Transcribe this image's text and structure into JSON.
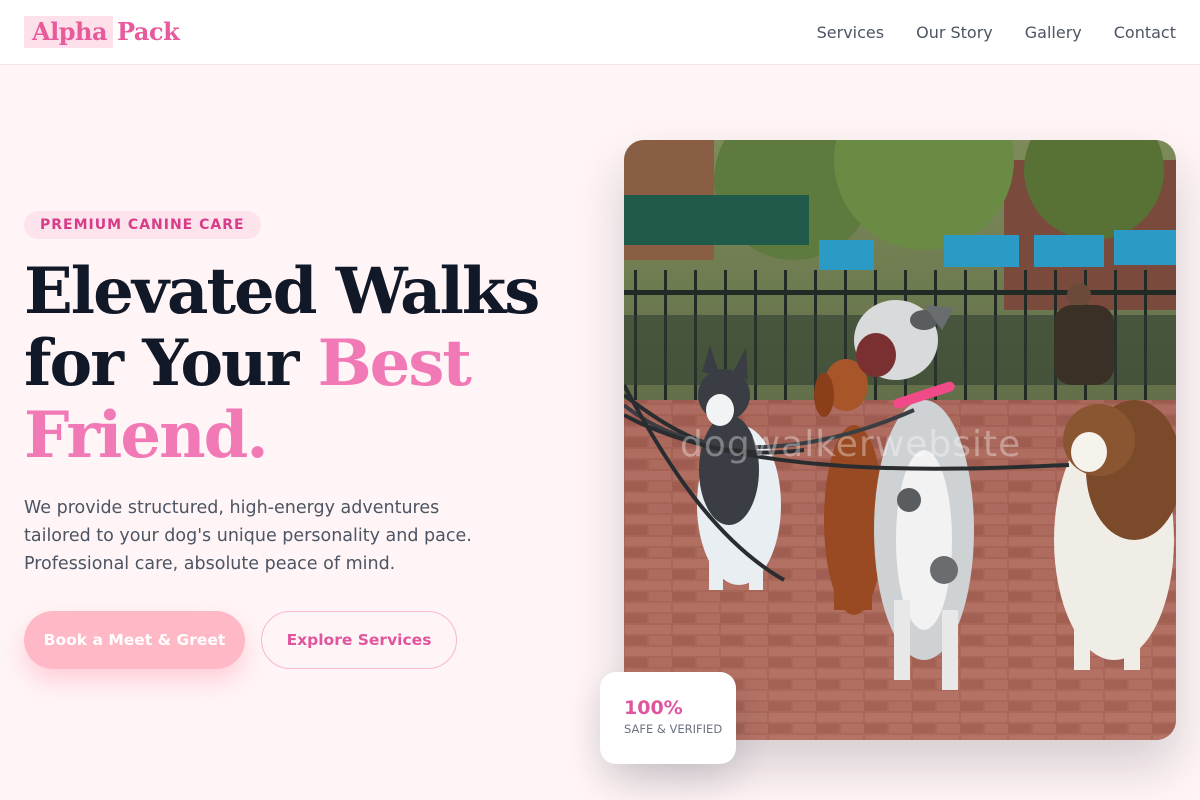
{
  "brand": {
    "logo_first": "Alpha",
    "logo_second": "Pack"
  },
  "nav": {
    "items": [
      {
        "label": "Services"
      },
      {
        "label": "Our Story"
      },
      {
        "label": "Gallery"
      },
      {
        "label": "Contact"
      }
    ]
  },
  "hero": {
    "badge": "PREMIUM CANINE CARE",
    "headline_line1": "Elevated Walks",
    "headline_line2_plain": "for Your ",
    "headline_line2_accent": "Best",
    "headline_line3": "Friend.",
    "lead": "We provide structured, high-energy adventures tailored to your dog's unique personality and pace. Professional care, absolute peace of mind.",
    "primary_button": "Book a Meet & Greet",
    "secondary_button": "Explore Services",
    "image_watermark": "dogwalkerwebsite"
  },
  "stat": {
    "value": "100%",
    "label": "SAFE & VERIFIED"
  },
  "colors": {
    "accent": "#f179b5",
    "accent_dark": "#e0559d",
    "heading": "#111827",
    "body_text": "#4b5563",
    "page_bg": "#fff5f6",
    "primary_button_bg": "#ffb8c6"
  }
}
